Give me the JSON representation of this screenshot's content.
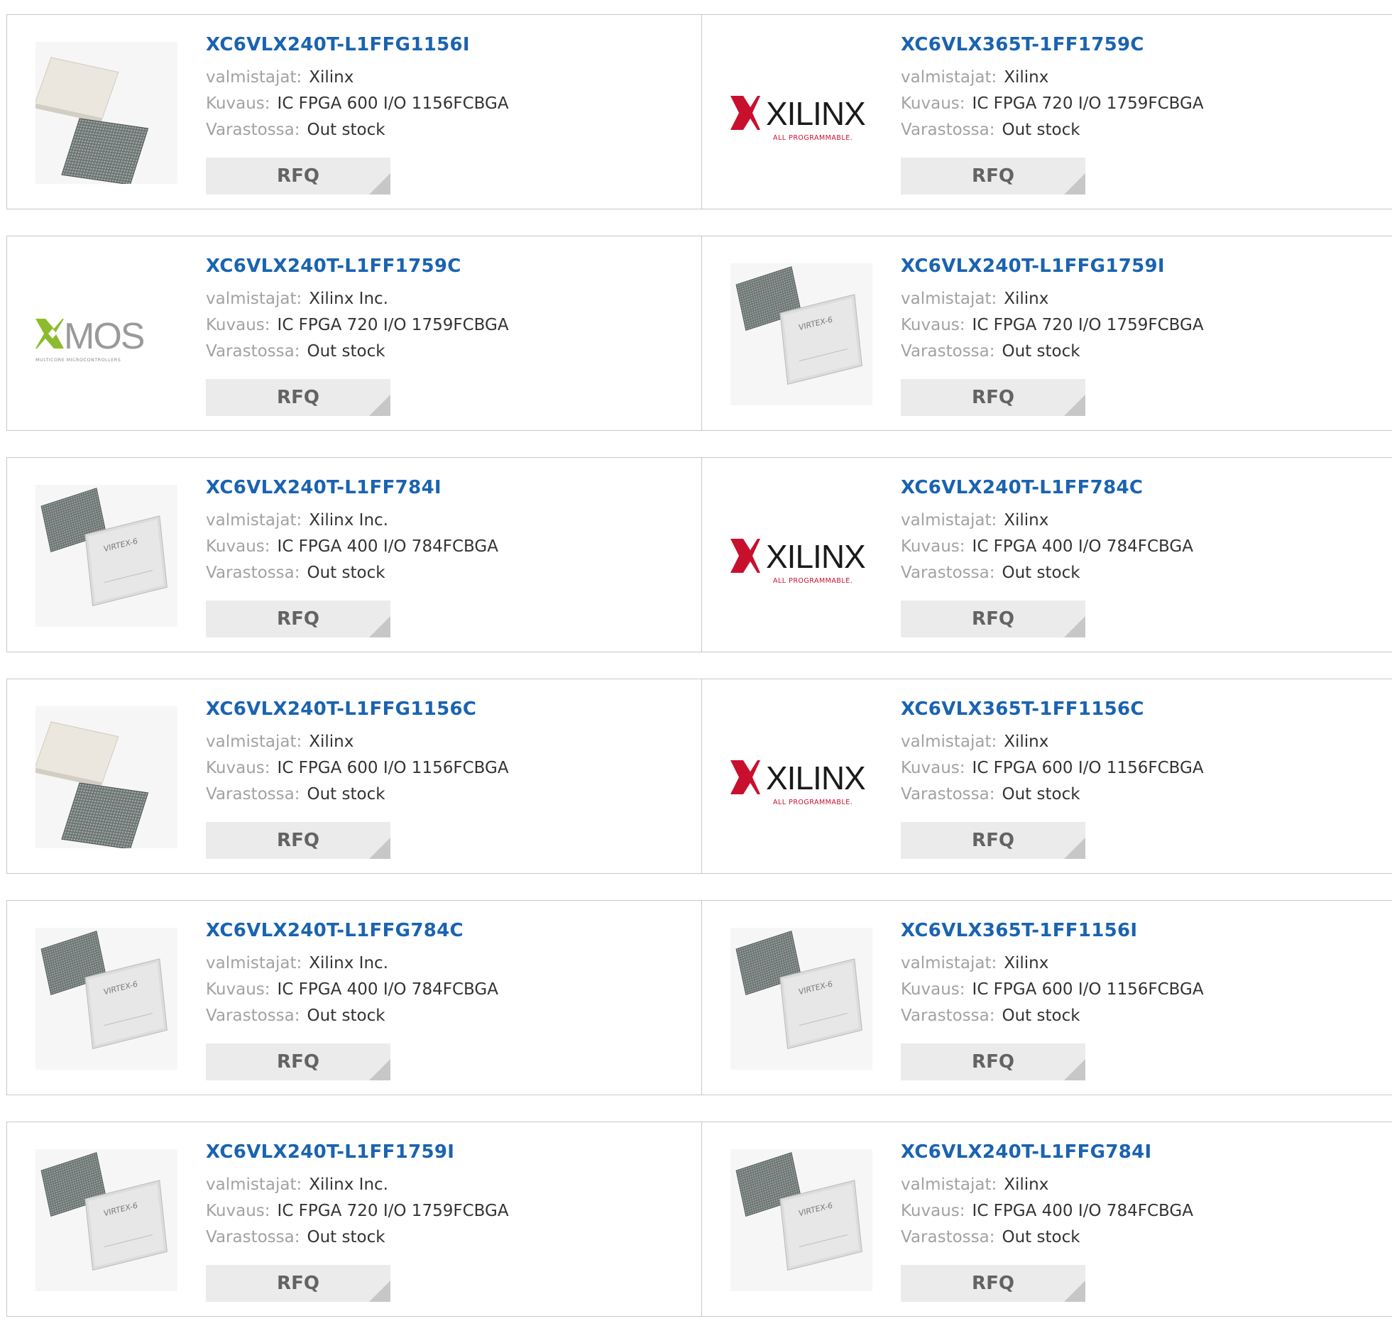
{
  "labels": {
    "manufacturer": "valmistajat:",
    "description": "Kuvaus:",
    "stock": "Varastossa:",
    "rfq": "RFQ"
  },
  "colors": {
    "part_link": "#1a63b0",
    "label": "#a2a2a2",
    "value": "#333333",
    "button_bg": "#ebebeb",
    "border": "#c8c8c8",
    "xilinx_red": "#c8102e"
  },
  "logo_text": {
    "xilinx_word": "XILINX",
    "xilinx_tagline": "ALL PROGRAMMABLE.",
    "xmos_word": "MOS",
    "xmos_tagline": "MULTICORE MICROCONTROLLERS"
  },
  "products": [
    {
      "part": "XC6VLX240T-L1FFG1156I",
      "manufacturer": "Xilinx",
      "description": "IC FPGA 600 I/O 1156FCBGA",
      "stock": "Out stock",
      "image": "chip-pair-icon"
    },
    {
      "part": "XC6VLX365T-1FF1759C",
      "manufacturer": "Xilinx",
      "description": "IC FPGA 720 I/O 1759FCBGA",
      "stock": "Out stock",
      "image": "xilinx-logo"
    },
    {
      "part": "XC6VLX240T-L1FF1759C",
      "manufacturer": "Xilinx Inc.",
      "description": "IC FPGA 720 I/O 1759FCBGA",
      "stock": "Out stock",
      "image": "xmos-logo"
    },
    {
      "part": "XC6VLX240T-L1FFG1759I",
      "manufacturer": "Xilinx",
      "description": "IC FPGA 720 I/O 1759FCBGA",
      "stock": "Out stock",
      "image": "virtex-chip-icon"
    },
    {
      "part": "XC6VLX240T-L1FF784I",
      "manufacturer": "Xilinx Inc.",
      "description": "IC FPGA 400 I/O 784FCBGA",
      "stock": "Out stock",
      "image": "virtex-chip-icon"
    },
    {
      "part": "XC6VLX240T-L1FF784C",
      "manufacturer": "Xilinx",
      "description": "IC FPGA 400 I/O 784FCBGA",
      "stock": "Out stock",
      "image": "xilinx-logo"
    },
    {
      "part": "XC6VLX240T-L1FFG1156C",
      "manufacturer": "Xilinx",
      "description": "IC FPGA 600 I/O 1156FCBGA",
      "stock": "Out stock",
      "image": "chip-pair-icon"
    },
    {
      "part": "XC6VLX365T-1FF1156C",
      "manufacturer": "Xilinx",
      "description": "IC FPGA 600 I/O 1156FCBGA",
      "stock": "Out stock",
      "image": "xilinx-logo"
    },
    {
      "part": "XC6VLX240T-L1FFG784C",
      "manufacturer": "Xilinx Inc.",
      "description": "IC FPGA 400 I/O 784FCBGA",
      "stock": "Out stock",
      "image": "virtex-chip-icon"
    },
    {
      "part": "XC6VLX365T-1FF1156I",
      "manufacturer": "Xilinx",
      "description": "IC FPGA 600 I/O 1156FCBGA",
      "stock": "Out stock",
      "image": "virtex-chip-icon"
    },
    {
      "part": "XC6VLX240T-L1FF1759I",
      "manufacturer": "Xilinx Inc.",
      "description": "IC FPGA 720 I/O 1759FCBGA",
      "stock": "Out stock",
      "image": "virtex-chip-icon"
    },
    {
      "part": "XC6VLX240T-L1FFG784I",
      "manufacturer": "Xilinx",
      "description": "IC FPGA 400 I/O 784FCBGA",
      "stock": "Out stock",
      "image": "virtex-chip-icon"
    }
  ]
}
